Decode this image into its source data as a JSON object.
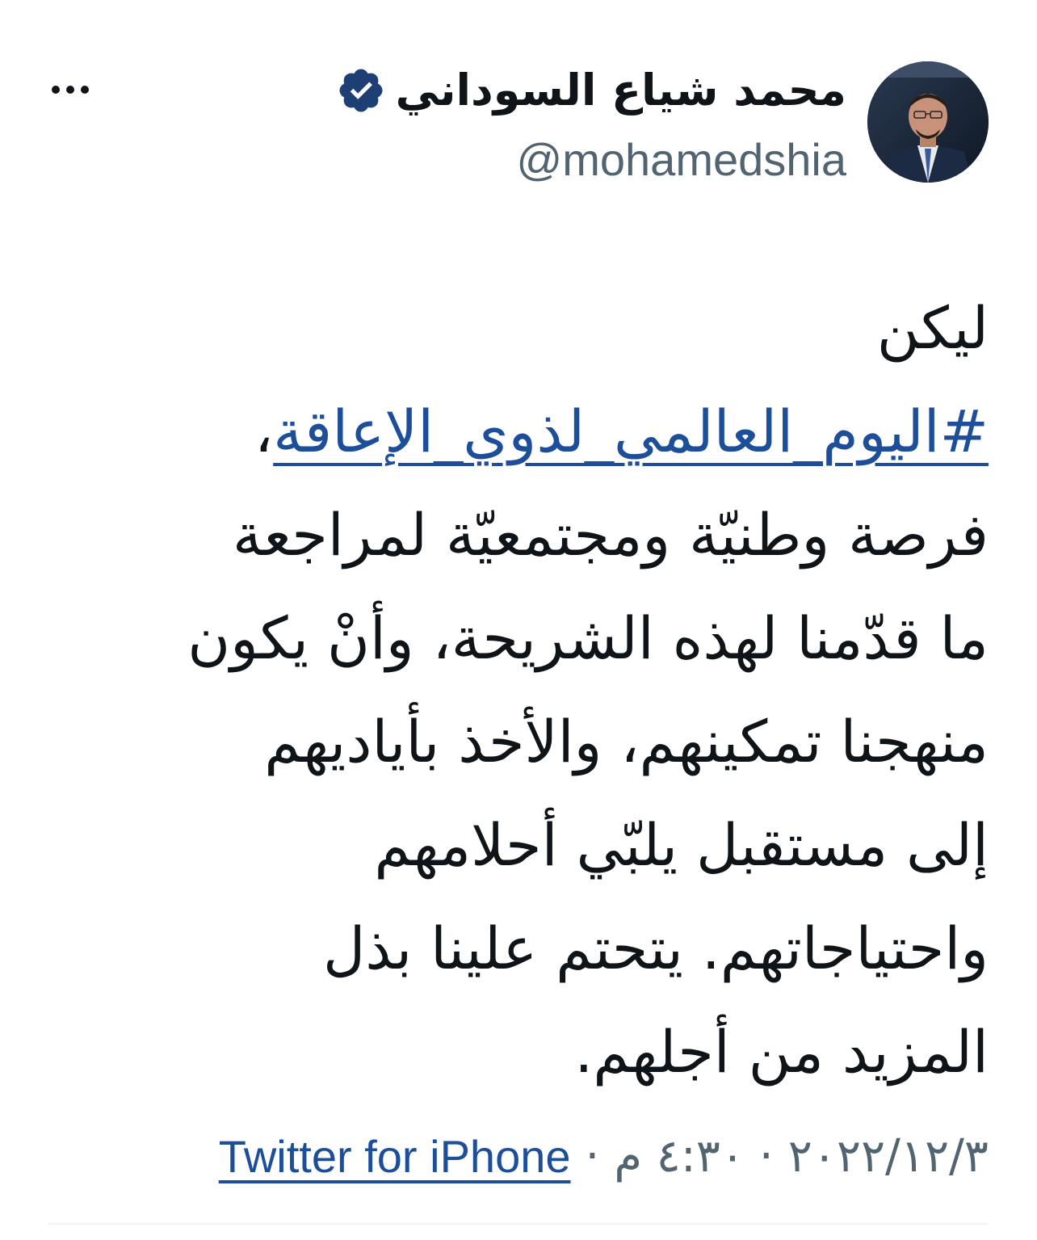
{
  "author": {
    "display_name": "محمد شياع السوداني",
    "handle": "@mohamedshia",
    "verified": true
  },
  "icons": {
    "verified": "verified-badge-icon",
    "more": "more-options-icon"
  },
  "tweet": {
    "line_1": "ليكن",
    "hashtag": "#اليوم_العالمي_لذوي_الإعاقة",
    "hashtag_suffix": "،",
    "line_3": "فرصة وطنيّة ومجتمعيّة لمراجعة",
    "line_4": "ما قدّمنا لهذه الشريحة، وأنْ يكون",
    "line_5": "منهجنا تمكينهم، والأخذ بأياديهم",
    "line_6": "إلى مستقبل يلبّي أحلامهم",
    "line_7": "واحتياجاتهم. يتحتم علينا بذل",
    "line_8": "المزيد من أجلهم."
  },
  "meta": {
    "date": "٢٠٢٢/١٢/٣",
    "separator": "·",
    "time": "٤:٣٠ م",
    "source": "Twitter for iPhone"
  },
  "colors": {
    "text": "#0f1419",
    "secondary": "#536471",
    "link": "#1d4e9a",
    "verified": "#1d3f73"
  }
}
